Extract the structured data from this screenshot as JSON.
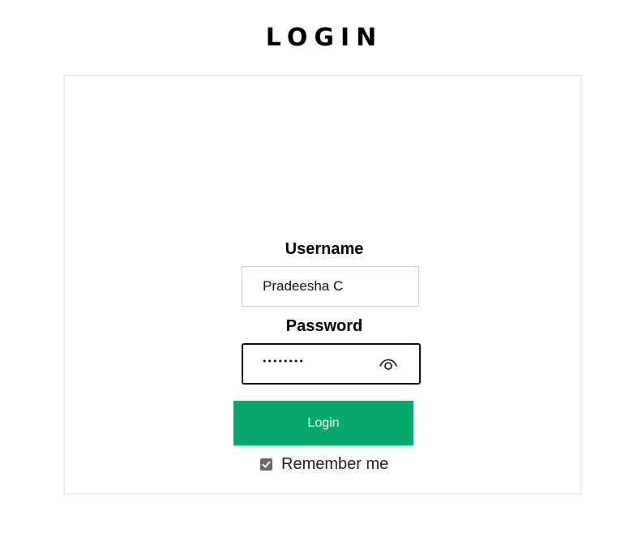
{
  "page": {
    "title": "LOGIN"
  },
  "form": {
    "username_label": "Username",
    "username_value": "Pradeesha C",
    "password_label": "Password",
    "password_masked": "••••••••",
    "login_button": "Login",
    "remember_label": "Remember me",
    "remember_checked": true
  },
  "icons": {
    "password_toggle": "eye-icon",
    "remember_check": "checkmark-icon"
  },
  "colors": {
    "button_green": "#05a96b",
    "card_border": "#ececec",
    "checkbox_fill": "#6b6b6b"
  }
}
